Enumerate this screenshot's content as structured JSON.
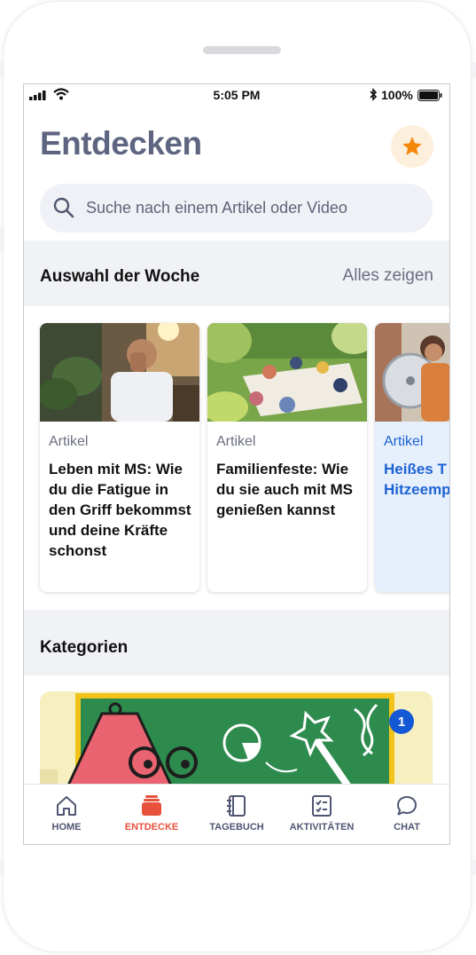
{
  "status_bar": {
    "time": "5:05 PM",
    "battery": "100%"
  },
  "header": {
    "title": "Entdecken",
    "favorites_icon": "star-icon"
  },
  "search": {
    "placeholder": "Suche nach einem Artikel oder Video"
  },
  "weekly": {
    "title": "Auswahl der Woche",
    "show_all": "Alles zeigen",
    "cards": [
      {
        "kind": "Artikel",
        "headline": "Leben mit MS: Wie du die Fatigue in den Griff bekommst und deine Kräfte schonst"
      },
      {
        "kind": "Artikel",
        "headline": "Familienfeste: Wie du sie auch mit MS genießen kannst"
      },
      {
        "kind": "Artikel",
        "headline": "Heißes T und Hitzeemp eit"
      }
    ]
  },
  "categories": {
    "title": "Kategorien",
    "badge": "1"
  },
  "tabbar": {
    "tabs": [
      {
        "label": "HOME",
        "icon": "home-icon"
      },
      {
        "label": "ENTDECKE",
        "icon": "discover-icon"
      },
      {
        "label": "TAGEBUCH",
        "icon": "diary-icon"
      },
      {
        "label": "AKTIVITÄTEN",
        "icon": "checklist-icon"
      },
      {
        "label": "CHAT",
        "icon": "chat-bubble-icon"
      }
    ],
    "active": "ENTDECKE"
  },
  "colors": {
    "title": "#5e6580",
    "accent": "#e8513c",
    "star": "#f5870a",
    "link_blue": "#1d63d4",
    "badge": "#1558d6"
  }
}
